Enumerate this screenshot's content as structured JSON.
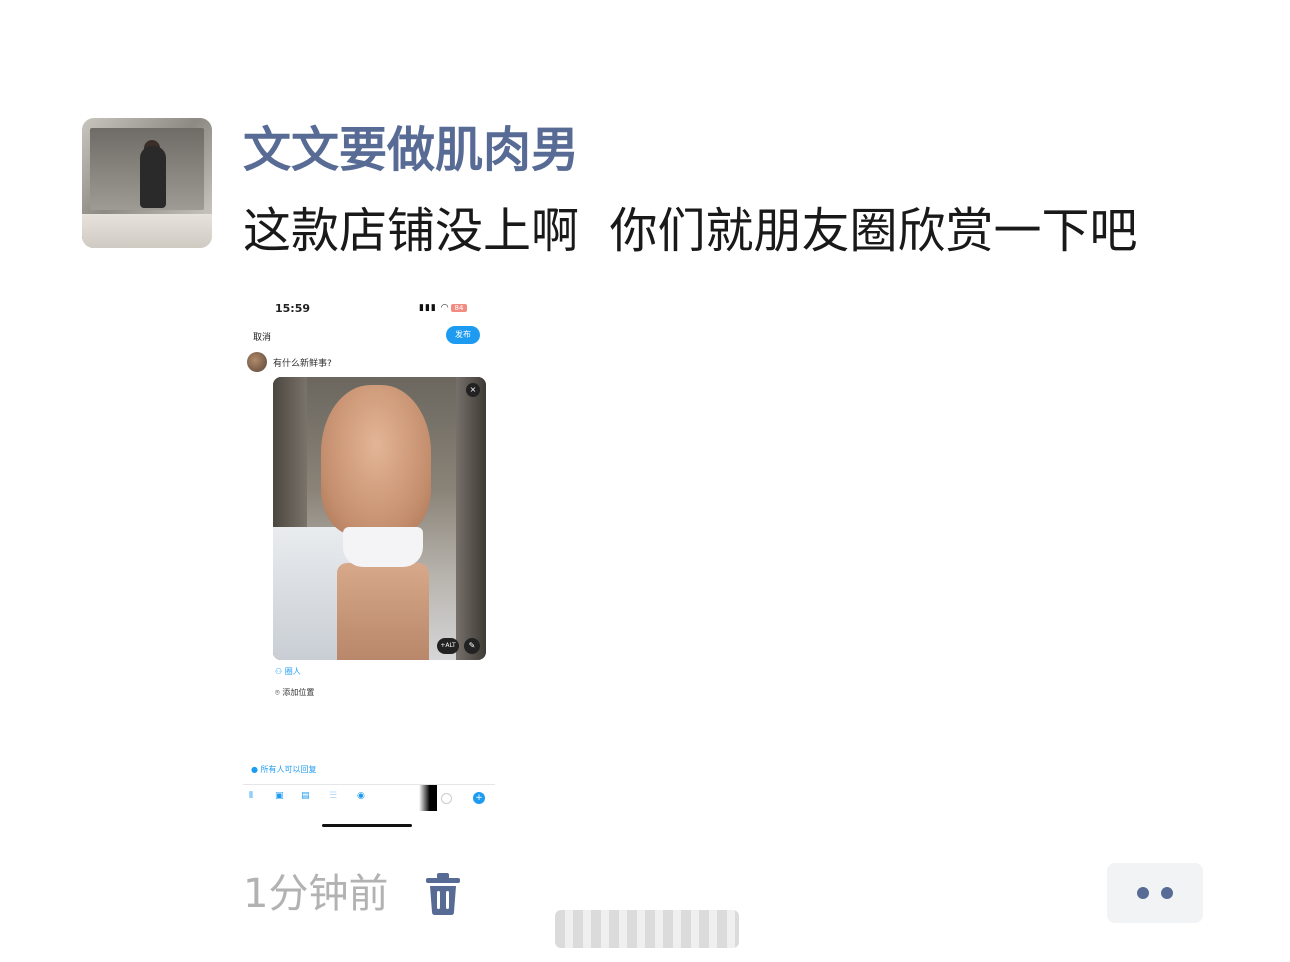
{
  "post": {
    "username": "文文要做肌肉男",
    "caption": "这款店铺没上啊  你们就朋友圈欣赏一下吧",
    "timestamp": "1分钟前",
    "link_color": "#576b95"
  },
  "embedded_screenshot": {
    "status_bar": {
      "time": "15:59",
      "battery": "84"
    },
    "cancel_label": "取消",
    "publish_label": "发布",
    "compose_placeholder": "有什么新鲜事?",
    "image_close": "×",
    "alt_label": "+ALT",
    "tag_people_label": "圈人",
    "add_location_label": "添加位置",
    "reply_setting_label": "所有人可以回复",
    "accent_color": "#1d9bf0"
  },
  "icons": [
    "trash-icon",
    "more-icon",
    "wifi-icon",
    "signal-icon",
    "location-icon",
    "person-icon"
  ]
}
